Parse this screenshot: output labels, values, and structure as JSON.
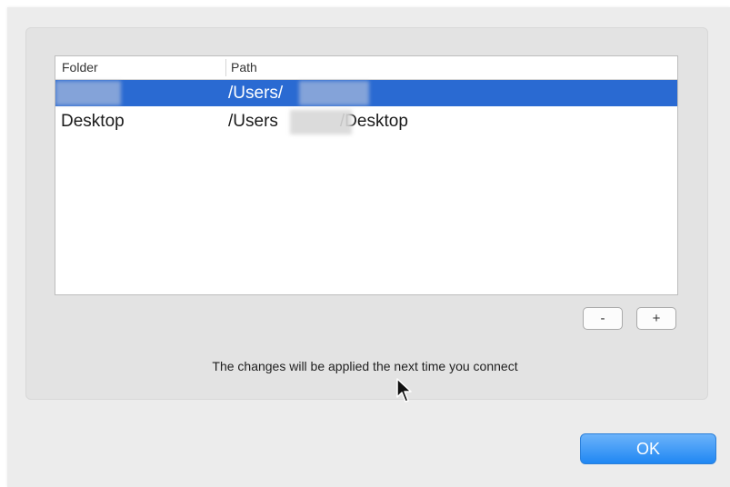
{
  "folders_table": {
    "headers": {
      "folder": "Folder",
      "path": "Path"
    },
    "rows": [
      {
        "folder": "",
        "path": "/Users/",
        "selected": true
      },
      {
        "folder": "Desktop",
        "path_prefix": "/Users",
        "path_suffix": "/Desktop",
        "selected": false
      }
    ]
  },
  "controls": {
    "remove_label": "-",
    "add_label": "+"
  },
  "note": "The changes will be applied the next time you connect",
  "ok_label": "OK",
  "colors": {
    "selection": "#2a6ad2",
    "ok_button": "#1f87f3"
  },
  "cursor_icon": "arrow-pointer-icon"
}
